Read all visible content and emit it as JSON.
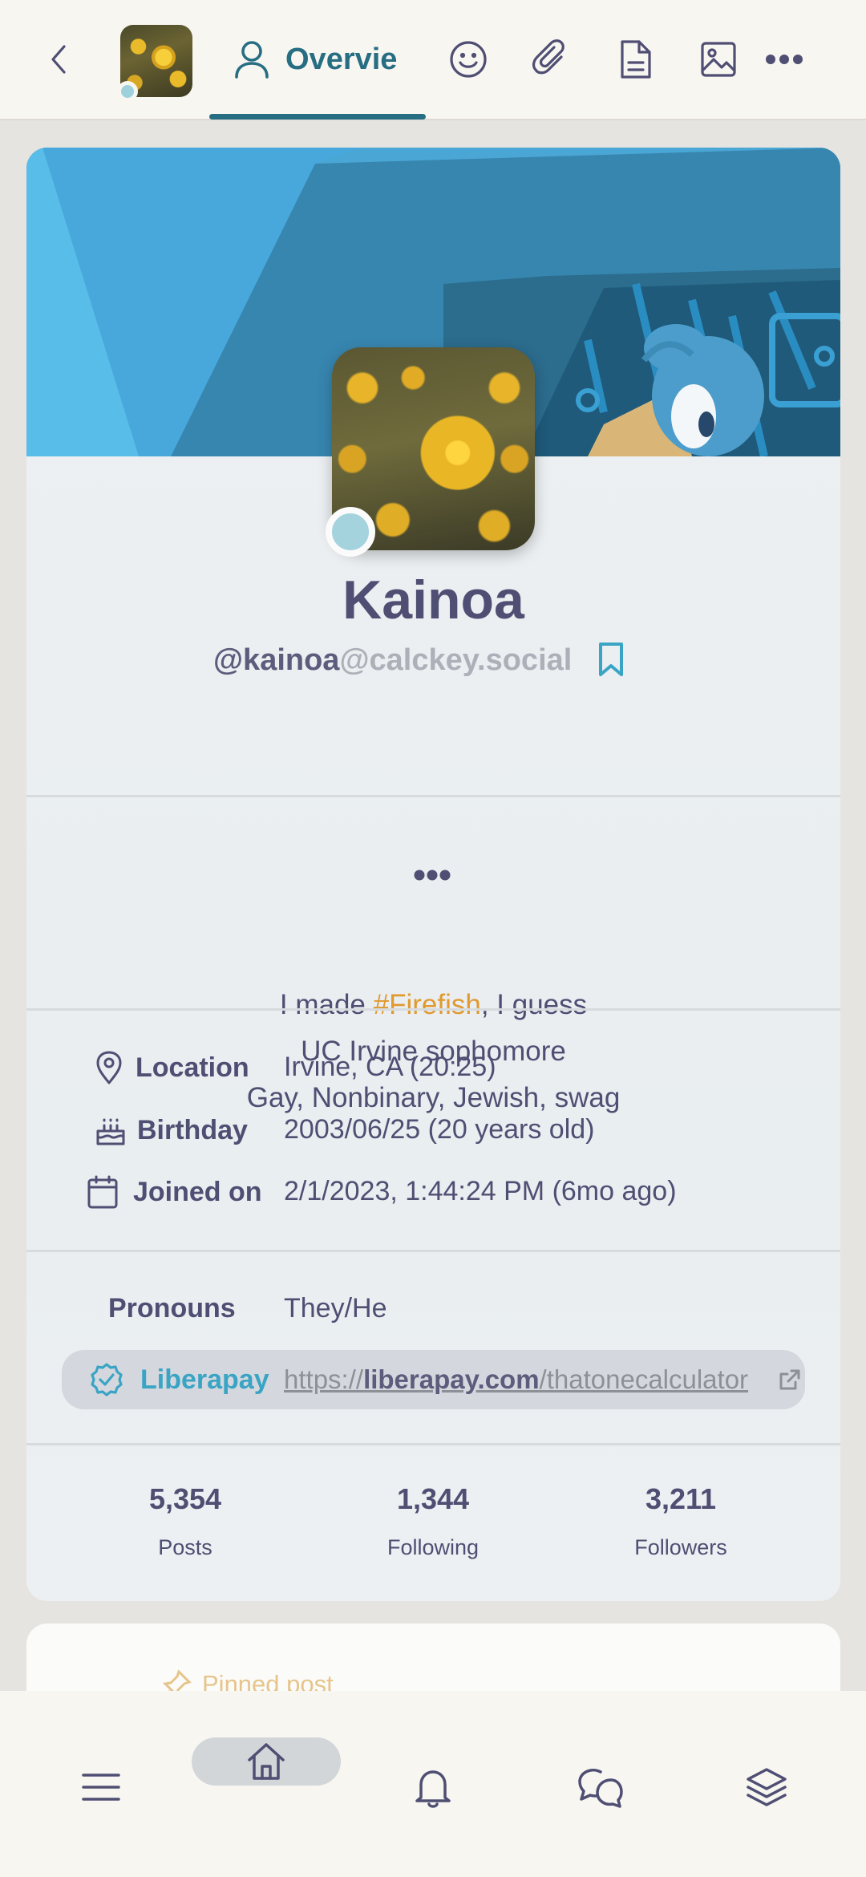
{
  "topbar": {
    "back_icon": "chevron-left-icon",
    "active_tab_label": "Overvie",
    "tabs": [
      "overview",
      "reactions",
      "clips",
      "pages",
      "gallery",
      "more"
    ]
  },
  "profile": {
    "display_name": "Kainoa",
    "username": "@kainoa",
    "host": "@calckey.social",
    "online": true
  },
  "bio": {
    "line1_pre": "I made ",
    "line1_tag": "#Firefish",
    "line1_post": ", I guess",
    "line2": "UC Irvine sophomore",
    "line3": "Gay, Nonbinary, Jewish, swag"
  },
  "info": {
    "location_key": "Location",
    "location_val": "Irvine, CA (20:25)",
    "birthday_key": "Birthday",
    "birthday_val": "2003/06/25 (20 years old)",
    "joined_key": "Joined on",
    "joined_val": "2/1/2023, 1:44:24 PM (6mo ago)"
  },
  "fields": {
    "pronouns_key": "Pronouns",
    "pronouns_val": "They/He",
    "liberapay_key": "Liberapay",
    "liberapay_scheme": "https://",
    "liberapay_domain": "liberapay.com",
    "liberapay_path": "/thatonecalculator"
  },
  "stats": {
    "posts_num": "5,354",
    "posts_label": "Posts",
    "following_num": "1,344",
    "following_label": "Following",
    "followers_num": "3,211",
    "followers_label": "Followers"
  },
  "pinned": {
    "label": "Pinned post"
  },
  "colors": {
    "accent": "#276e83",
    "text": "#4f4e73",
    "hashtag": "#e09a30",
    "link": "#3aa4c5",
    "online": "#a4d3de"
  }
}
